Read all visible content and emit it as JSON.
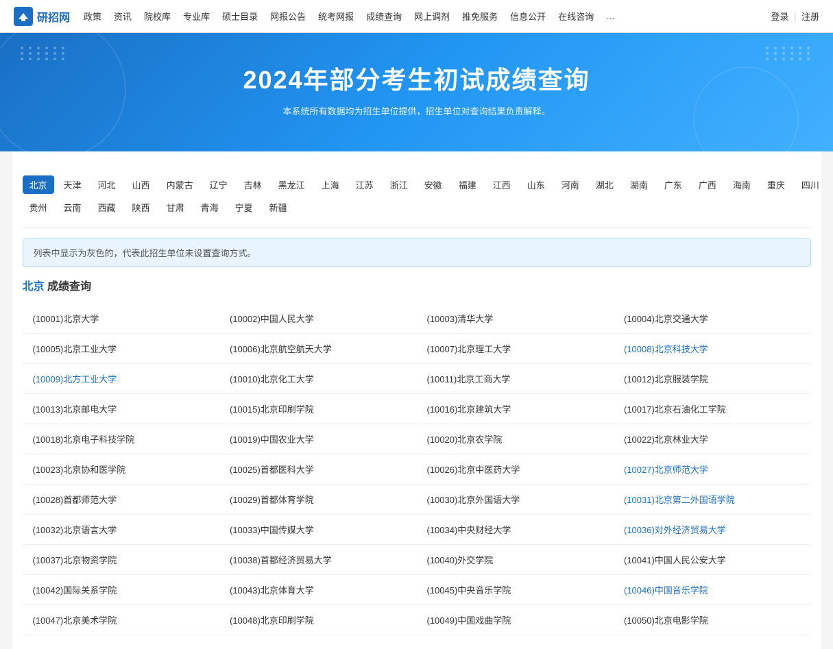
{
  "nav": {
    "logo_text": "研招网",
    "links": [
      "政策",
      "资讯",
      "院校库",
      "专业库",
      "硕士目录",
      "网报公告",
      "统考网报",
      "成绩查询",
      "网上调剂",
      "推免服务",
      "信息公开",
      "在线咨询",
      "..."
    ],
    "login": "登录",
    "register": "注册",
    "divider": "|"
  },
  "hero": {
    "title": "2024年部分考生初试成绩查询",
    "subtitle": "本系统所有数据均为招生单位提供，招生单位对查询结果负责解释。"
  },
  "provinces": {
    "row1": [
      "北京",
      "天津",
      "河北",
      "山西",
      "内蒙古",
      "辽宁",
      "吉林",
      "黑龙江",
      "上海",
      "江苏",
      "浙江",
      "安徽",
      "福建",
      "江西",
      "山东",
      "河南",
      "湖北",
      "湖南",
      "广东",
      "广西",
      "海南",
      "重庆",
      "四川"
    ],
    "row2": [
      "贵州",
      "云南",
      "西藏",
      "陕西",
      "甘肃",
      "青海",
      "宁夏",
      "新疆"
    ],
    "active": "北京"
  },
  "info_text": "列表中显示为灰色的，代表此招生单位未设置查询方式。",
  "section": {
    "city": "北京",
    "label": "成绩查询"
  },
  "schools": [
    {
      "id": "10001",
      "name": "北京大学",
      "link": false
    },
    {
      "id": "10002",
      "name": "中国人民大学",
      "link": false
    },
    {
      "id": "10003",
      "name": "清华大学",
      "link": false
    },
    {
      "id": "10004",
      "name": "北京交通大学",
      "link": false
    },
    {
      "id": "10005",
      "name": "北京工业大学",
      "link": false
    },
    {
      "id": "10006",
      "name": "北京航空航天大学",
      "link": false
    },
    {
      "id": "10007",
      "name": "北京理工大学",
      "link": false
    },
    {
      "id": "10008",
      "name": "北京科技大学",
      "link": true
    },
    {
      "id": "10009",
      "name": "北方工业大学",
      "link": true
    },
    {
      "id": "10010",
      "name": "北京化工大学",
      "link": false
    },
    {
      "id": "10011",
      "name": "北京工商大学",
      "link": false
    },
    {
      "id": "10012",
      "name": "北京服装学院",
      "link": false
    },
    {
      "id": "10013",
      "name": "北京邮电大学",
      "link": false
    },
    {
      "id": "10015",
      "name": "北京印刷学院",
      "link": false
    },
    {
      "id": "10016",
      "name": "北京建筑大学",
      "link": false
    },
    {
      "id": "10017",
      "name": "北京石油化工学院",
      "link": false
    },
    {
      "id": "10018",
      "name": "北京电子科技学院",
      "link": false
    },
    {
      "id": "10019",
      "name": "中国农业大学",
      "link": false
    },
    {
      "id": "10020",
      "name": "北京农学院",
      "link": false
    },
    {
      "id": "10022",
      "name": "北京林业大学",
      "link": false
    },
    {
      "id": "10023",
      "name": "北京协和医学院",
      "link": false
    },
    {
      "id": "10025",
      "name": "首都医科大学",
      "link": false
    },
    {
      "id": "10026",
      "name": "北京中医药大学",
      "link": false
    },
    {
      "id": "10027",
      "name": "北京师范大学",
      "link": true
    },
    {
      "id": "10028",
      "name": "首都师范大学",
      "link": false
    },
    {
      "id": "10029",
      "name": "首都体育学院",
      "link": false
    },
    {
      "id": "10030",
      "name": "北京外国语大学",
      "link": false
    },
    {
      "id": "10031",
      "name": "北京第二外国语学院",
      "link": true
    },
    {
      "id": "10032",
      "name": "北京语言大学",
      "link": false
    },
    {
      "id": "10033",
      "name": "中国传媒大学",
      "link": false
    },
    {
      "id": "10034",
      "name": "中央财经大学",
      "link": false
    },
    {
      "id": "10036",
      "name": "对外经济贸易大学",
      "link": true
    },
    {
      "id": "10037",
      "name": "北京物资学院",
      "link": false
    },
    {
      "id": "10038",
      "name": "首都经济贸易大学",
      "link": false
    },
    {
      "id": "10040",
      "name": "外交学院",
      "link": false
    },
    {
      "id": "10041",
      "name": "中国人民公安大学",
      "link": false
    },
    {
      "id": "10042",
      "name": "国际关系学院",
      "link": false
    },
    {
      "id": "10043",
      "name": "北京体育大学",
      "link": false
    },
    {
      "id": "10045",
      "name": "中央音乐学院",
      "link": false
    },
    {
      "id": "10046",
      "name": "中国音乐学院",
      "link": true
    },
    {
      "id": "10047",
      "name": "北京美术学院",
      "link": false
    },
    {
      "id": "10048",
      "name": "北京印刷学院",
      "link": false
    },
    {
      "id": "10049",
      "name": "中国戏曲学院",
      "link": false
    },
    {
      "id": "10050",
      "name": "北京电影学院",
      "link": false
    }
  ]
}
